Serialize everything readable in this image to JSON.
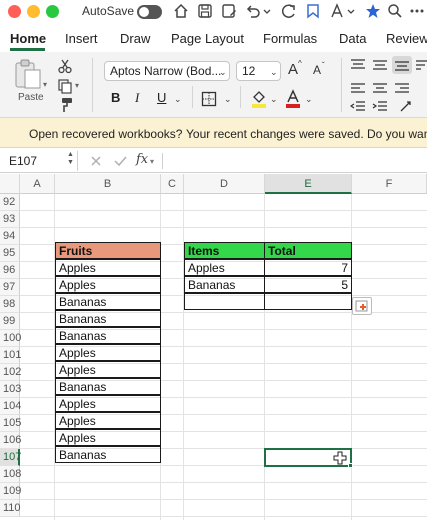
{
  "titlebar": {
    "autosave_label": "AutoSave",
    "traffic_colors": [
      "#ff5f57",
      "#febc2e",
      "#28c840"
    ]
  },
  "tabs": [
    {
      "label": "Home",
      "active": true
    },
    {
      "label": "Insert"
    },
    {
      "label": "Draw"
    },
    {
      "label": "Page Layout"
    },
    {
      "label": "Formulas"
    },
    {
      "label": "Data"
    },
    {
      "label": "Review"
    }
  ],
  "ribbon": {
    "paste_label": "Paste",
    "font_name": "Aptos Narrow (Bod...",
    "font_size": "12",
    "bold": "B",
    "italic": "I",
    "underline": "U",
    "grow_font": "A",
    "shrink_font": "A",
    "accent_green": "#1e7145",
    "fill_color": "#f5e83a",
    "font_color": "#d82020"
  },
  "message_bar": {
    "title": "Open recovered workbooks?",
    "body": "Your recent changes were saved. Do you want to"
  },
  "formula_bar": {
    "name_box": "E107",
    "fx": "fx",
    "formula": ""
  },
  "grid": {
    "columns": [
      "A",
      "B",
      "C",
      "D",
      "E",
      "F"
    ],
    "selected_column": "E",
    "rows": [
      "92",
      "93",
      "94",
      "95",
      "96",
      "97",
      "98",
      "99",
      "100",
      "101",
      "102",
      "103",
      "104",
      "105",
      "106",
      "107",
      "108",
      "109",
      "110"
    ],
    "selected_row": "107",
    "fruits_table": {
      "header": "Fruits",
      "values": [
        "Apples",
        "Apples",
        "Bananas",
        "Bananas",
        "Bananas",
        "Apples",
        "Apples",
        "Bananas",
        "Apples",
        "Apples",
        "Apples",
        "Bananas"
      ]
    },
    "summary_table": {
      "headers": [
        "Items",
        "Total"
      ],
      "rows": [
        {
          "item": "Apples",
          "total": "7"
        },
        {
          "item": "Bananas",
          "total": "5"
        },
        {
          "item": "",
          "total": ""
        }
      ]
    }
  }
}
